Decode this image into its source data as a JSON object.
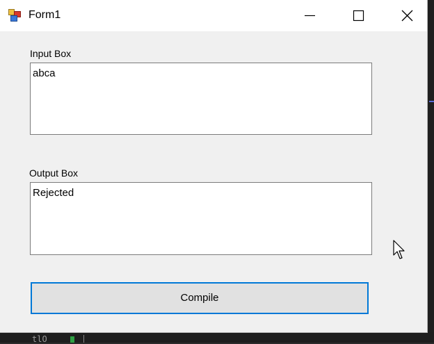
{
  "window": {
    "title": "Form1",
    "icon": "winforms-app-icon",
    "controls": [
      "minimize-icon",
      "maximize-icon",
      "close-icon"
    ]
  },
  "form": {
    "input_label": "Input Box",
    "input_value": "abca",
    "output_label": "Output Box",
    "output_value": "Rejected",
    "compile_label": "Compile"
  },
  "background": {
    "partial_text": "tlO"
  },
  "colors": {
    "accent": "#0078d7",
    "window_bg": "#f0f0f0",
    "titlebar_bg": "#ffffff",
    "button_bg": "#e1e1e1"
  }
}
